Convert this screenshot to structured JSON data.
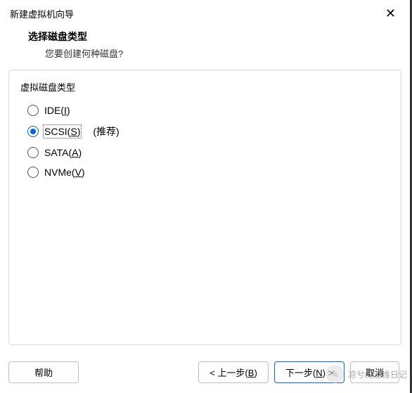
{
  "window": {
    "title": "新建虚拟机向导"
  },
  "header": {
    "title": "选择磁盘类型",
    "subtitle": "您要创建何种磁盘?"
  },
  "group": {
    "label": "虚拟磁盘类型",
    "options": [
      {
        "prefix": "IDE(",
        "mnemonic": "I",
        "suffix": ")",
        "hint": "",
        "selected": false
      },
      {
        "prefix": "SCSI(",
        "mnemonic": "S",
        "suffix": ")",
        "hint": "(推荐)",
        "selected": true
      },
      {
        "prefix": "SATA(",
        "mnemonic": "A",
        "suffix": ")",
        "hint": "",
        "selected": false
      },
      {
        "prefix": "NVMe(",
        "mnemonic": "V",
        "suffix": ")",
        "hint": "",
        "selected": false
      }
    ]
  },
  "footer": {
    "help": "帮助",
    "back_prefix": "< 上一步(",
    "back_mnemonic": "B",
    "back_suffix": ")",
    "next_prefix": "下一步(",
    "next_mnemonic": "N",
    "next_suffix": ") >",
    "cancel": "取消"
  },
  "watermark": {
    "text": "凉兮的运维日记"
  }
}
